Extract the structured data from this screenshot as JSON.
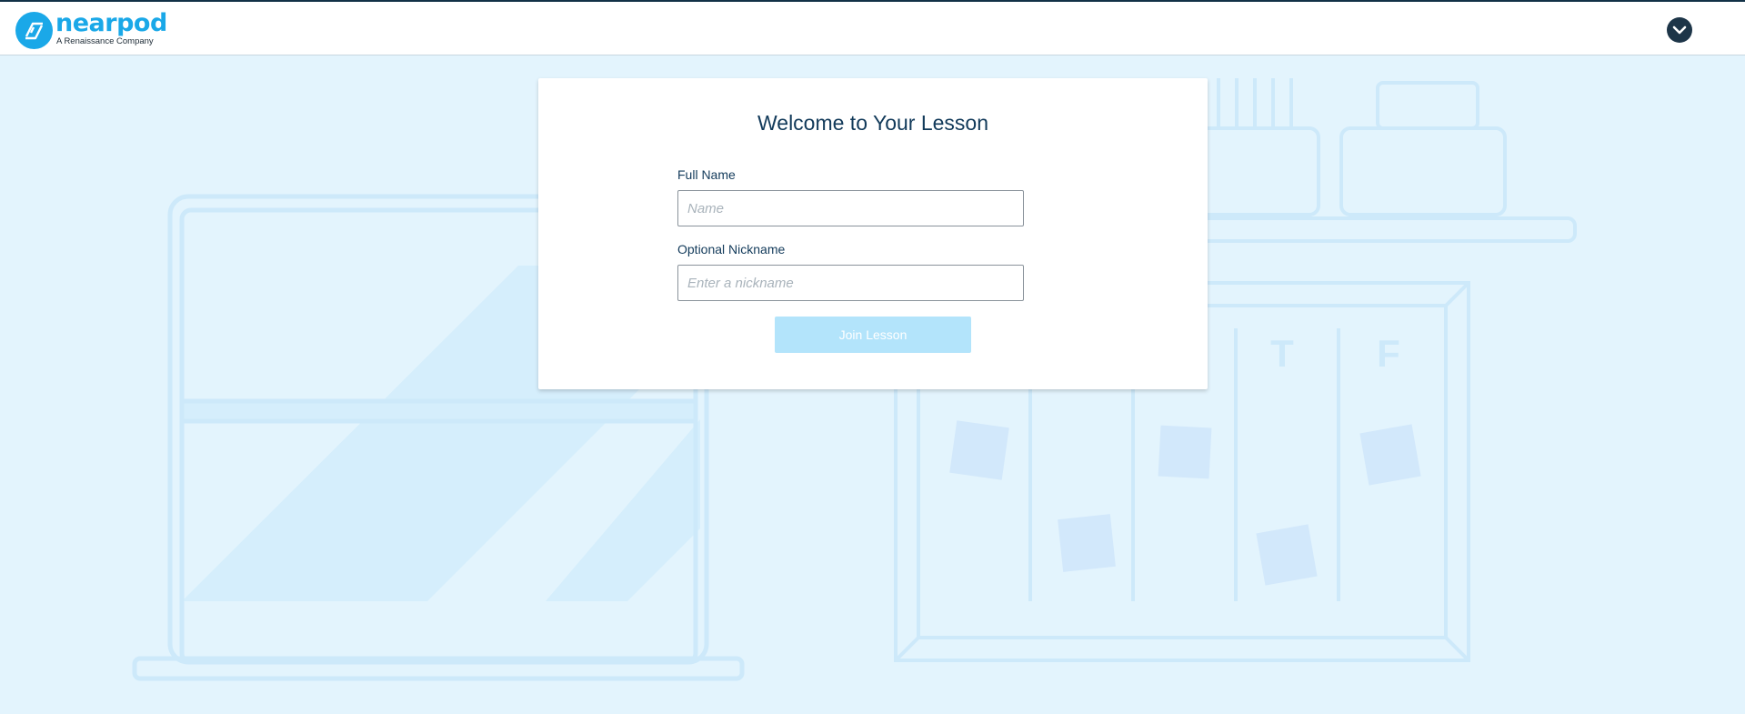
{
  "header": {
    "logo_text": "nearpod",
    "logo_subtitle": "A Renaissance Company",
    "menu_icon": "chevron-down-icon"
  },
  "background": {
    "calendar_letters": [
      "T",
      "F"
    ]
  },
  "card": {
    "title": "Welcome to Your Lesson",
    "full_name": {
      "label": "Full Name",
      "placeholder": "Name",
      "value": ""
    },
    "nickname": {
      "label": "Optional Nickname",
      "placeholder": "Enter a nickname",
      "value": ""
    },
    "join_button_label": "Join Lesson"
  },
  "colors": {
    "brand": "#1aa8e8",
    "navy": "#123a5a",
    "background": "#e3f4fd",
    "button_disabled": "#b3e4fb"
  }
}
